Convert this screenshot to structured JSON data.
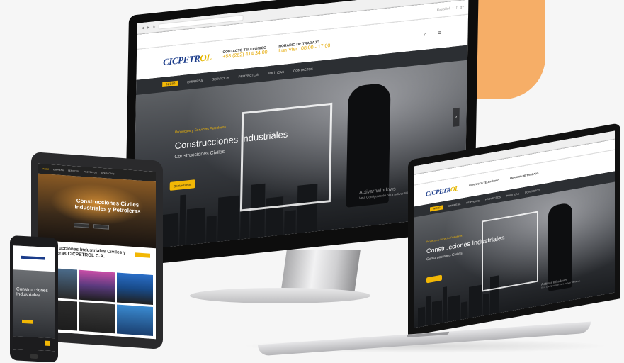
{
  "colors": {
    "accent": "#f2b705",
    "brand_blue": "#1b3c8a",
    "dark": "#1e2023",
    "orange_blob": "#f5a75a"
  },
  "monitor": {
    "topbar_lang": "Español",
    "social_icons": [
      "twitter-icon",
      "facebook-icon",
      "google-plus-icon"
    ],
    "logo_main": "CICPETR",
    "logo_accent": "OL",
    "contact_title": "CONTACTO TELEFÓNICO",
    "contact_value": "+58 (262) 414 34 00",
    "hours_title": "HORARIO DE TRABAJO",
    "hours_value": "Lun-Vier.: 08:00 - 17:00",
    "nav": [
      "INICIO",
      "EMPRESA",
      "SERVICIOS",
      "PROYECTOS",
      "POLÍTICAS",
      "CONTACTOS"
    ],
    "hero_tag": "Proyectos y Servicios Petroleros",
    "hero_title": "Construcciones Industriales",
    "hero_subtitle": "Construcciones Civiles",
    "hero_button": "Contáctanos",
    "watermark_line1": "Activar Windows",
    "watermark_line2": "Ve a Configuración para activar Windows."
  },
  "tablet": {
    "nav": [
      "INICIO",
      "EMPRESA",
      "SERVICIOS",
      "PROYECTOS",
      "CONTACTOS"
    ],
    "hero_title": "Construcciones Civiles Industriales y Petroleras",
    "section_title": "Construcciones Industriales Civiles y Petroleras CICPETROL C.A."
  },
  "phone": {
    "hero_title": "Construcciones Industriales"
  },
  "laptop": {
    "logo_main": "CICPETR",
    "logo_accent": "OL",
    "contact_title": "CONTACTO TELEFÓNICO",
    "hours_title": "HORARIO DE TRABAJO",
    "nav": [
      "INICIO",
      "EMPRESA",
      "SERVICIOS",
      "PROYECTOS",
      "POLÍTICAS",
      "CONTACTOS"
    ],
    "hero_tag": "Proyectos y Servicios Petroleros",
    "hero_title": "Construcciones Industriales",
    "hero_subtitle": "Construcciones Civiles",
    "watermark_line1": "Activar Windows",
    "watermark_line2": "Ve a Configuración para activar Windows."
  }
}
